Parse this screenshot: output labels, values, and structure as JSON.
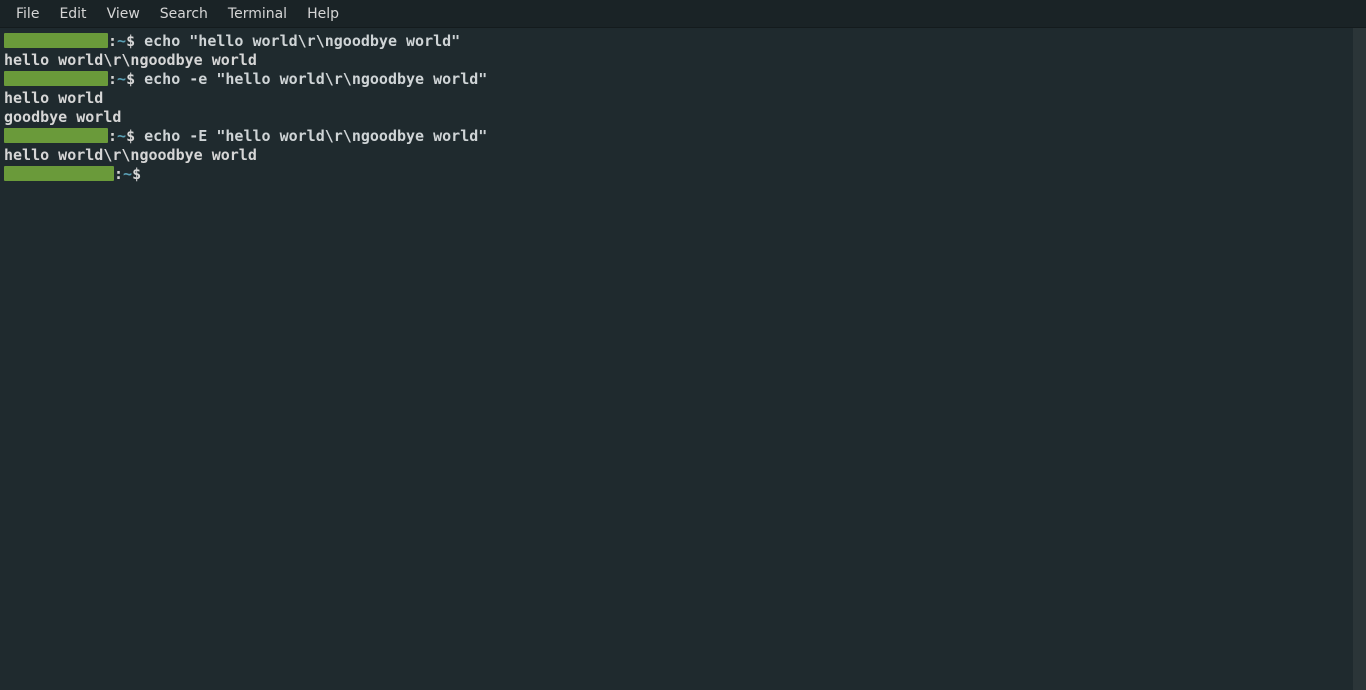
{
  "menubar": {
    "items": [
      "File",
      "Edit",
      "View",
      "Search",
      "Terminal",
      "Help"
    ]
  },
  "prompt": {
    "sep": ":",
    "path": "~",
    "symbol": "$"
  },
  "lines": [
    {
      "type": "prompt",
      "cmd": "echo \"hello world\\r\\ngoodbye world\""
    },
    {
      "type": "out",
      "text": "hello world\\r\\ngoodbye world"
    },
    {
      "type": "prompt",
      "cmd": "echo -e \"hello world\\r\\ngoodbye world\""
    },
    {
      "type": "out",
      "text": "hello world"
    },
    {
      "type": "out",
      "text": "goodbye world"
    },
    {
      "type": "prompt",
      "cmd": "echo -E \"hello world\\r\\ngoodbye world\""
    },
    {
      "type": "out",
      "text": "hello world\\r\\ngoodbye world"
    },
    {
      "type": "prompt",
      "cmd": "",
      "wide": true
    }
  ]
}
